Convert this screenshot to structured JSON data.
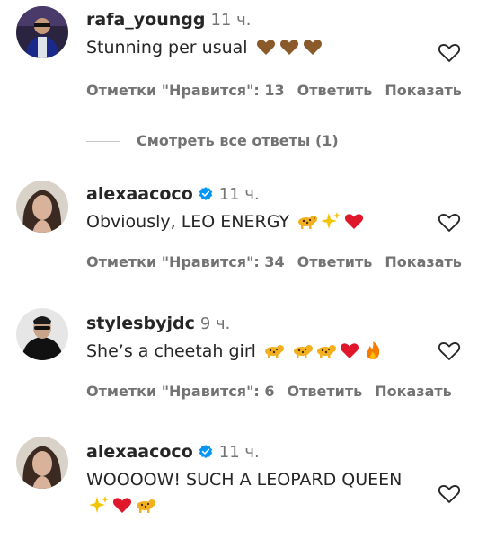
{
  "comments": [
    {
      "username": "rafa_youngg",
      "time": "11 ч.",
      "text": "Stunning per usual",
      "emoji": [
        "brown-heart",
        "brown-heart",
        "brown-heart"
      ],
      "likes_label": "Отметки \"Нравится\": 13",
      "reply_label": "Ответить",
      "show_label": "Показать"
    },
    {
      "username": "alexaacoco",
      "time": "11 ч.",
      "text": "Obviously, LEO ENERGY",
      "emoji": [
        "leopard",
        "sparkles",
        "red-heart"
      ],
      "likes_label": "Отметки \"Нравится\": 34",
      "reply_label": "Ответить",
      "show_label": "Показать"
    },
    {
      "username": "stylesbyjdc",
      "time": "9 ч.",
      "text": "She’s a cheetah girl",
      "emoji": [
        "leopard",
        "leopard",
        "leopard",
        "red-heart",
        "fire"
      ],
      "likes_label": "Отметки \"Нравится\": 6",
      "reply_label": "Ответить",
      "show_label": "Показать"
    },
    {
      "username": "alexaacoco",
      "time": "11 ч.",
      "text": "WOOOOW! SUCH A LEOPARD QUEEN",
      "emoji": [
        "sparkles",
        "red-heart",
        "leopard"
      ]
    }
  ],
  "view_replies": "Смотреть все ответы (1)",
  "colors": {
    "text": "#262626",
    "muted": "#737373",
    "verified": "#0095f6",
    "heart_red": "#e0162b",
    "brown": "#8b5a2b"
  }
}
